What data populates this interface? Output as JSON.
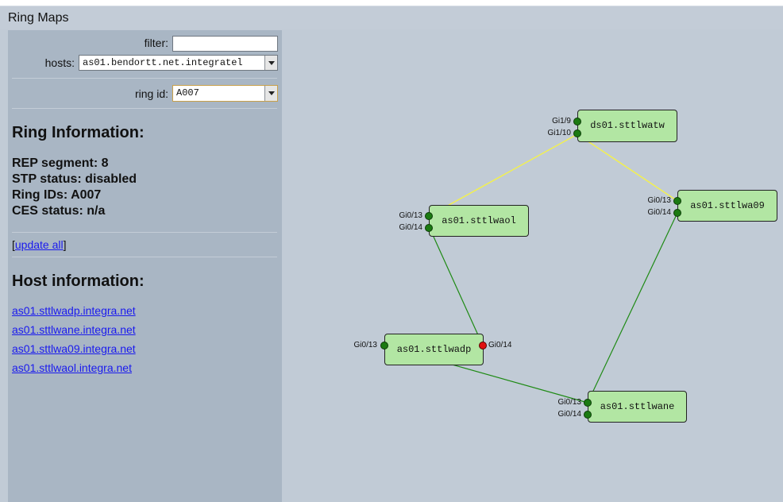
{
  "app": {
    "title": "Ring Maps"
  },
  "controls": {
    "filter_label": "filter:",
    "filter_value": "",
    "hosts_label": "hosts:",
    "hosts_selected": "as01.bendortt.net.integratel",
    "ring_id_label": "ring id:",
    "ring_id_selected": "A007"
  },
  "ring_info": {
    "heading": "Ring Information:",
    "lines": [
      "REP segment: 8",
      "STP status: disabled",
      "Ring IDs: A007",
      "CES status: n/a"
    ],
    "update_open": "[",
    "update_label": "update all",
    "update_close": "]"
  },
  "host_info": {
    "heading": "Host information:",
    "links": [
      "as01.sttlwadp.integra.net",
      "as01.sttlwane.integra.net",
      "as01.sttlwa09.integra.net",
      "as01.sttlwaol.integra.net"
    ]
  },
  "map": {
    "nodes": [
      {
        "name": "ds01.sttlwatw",
        "ports": [
          {
            "label": "Gi1/9",
            "status": "up"
          },
          {
            "label": "Gi1/10",
            "status": "up"
          }
        ]
      },
      {
        "name": "as01.sttlwa09",
        "ports": [
          {
            "label": "Gi0/13",
            "status": "up"
          },
          {
            "label": "Gi0/14",
            "status": "up"
          }
        ]
      },
      {
        "name": "as01.sttlwaol",
        "ports": [
          {
            "label": "Gi0/13",
            "status": "up"
          },
          {
            "label": "Gi0/14",
            "status": "up"
          }
        ]
      },
      {
        "name": "as01.sttlwadp",
        "ports": [
          {
            "label": "Gi0/13",
            "status": "up"
          },
          {
            "label": "Gi0/14",
            "status": "down"
          }
        ]
      },
      {
        "name": "as01.sttlwane",
        "ports": [
          {
            "label": "Gi0/13",
            "status": "up"
          },
          {
            "label": "Gi0/14",
            "status": "up"
          }
        ]
      }
    ],
    "link_colors": {
      "yellow": "#f2f050",
      "green": "#1e8a14"
    }
  }
}
